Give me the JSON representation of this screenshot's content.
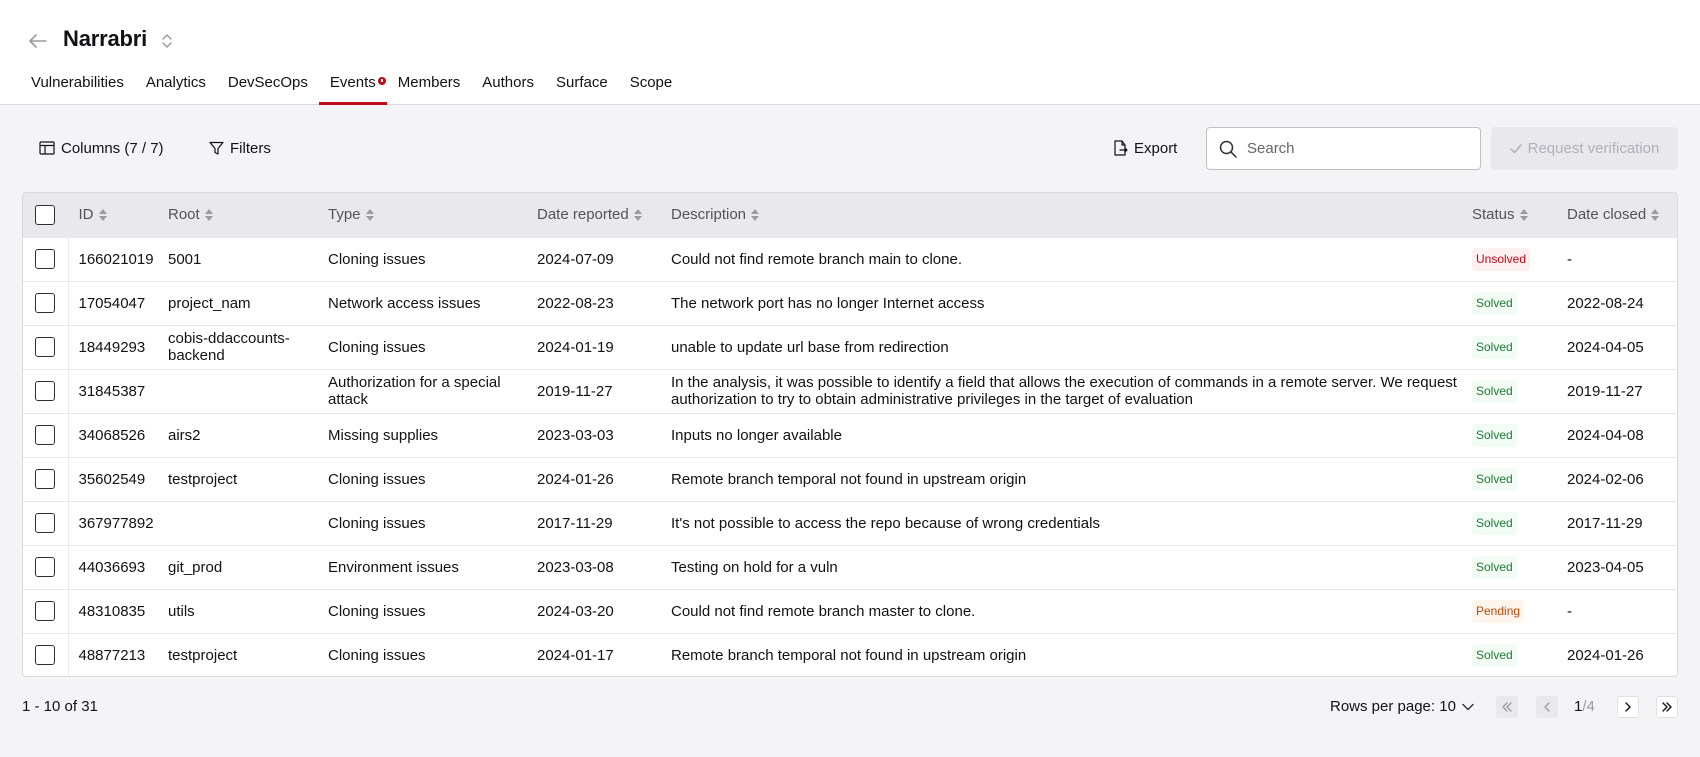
{
  "header": {
    "title": "Narrabri"
  },
  "tabs": [
    {
      "label": "Vulnerabilities"
    },
    {
      "label": "Analytics"
    },
    {
      "label": "DevSecOps"
    },
    {
      "label": "Events"
    },
    {
      "label": "Members"
    },
    {
      "label": "Authors"
    },
    {
      "label": "Surface"
    },
    {
      "label": "Scope"
    }
  ],
  "active_tab": "Events",
  "toolbar": {
    "columns_label": "Columns (7 / 7)",
    "filters_label": "Filters",
    "export_label": "Export",
    "search_placeholder": "Search",
    "request_label": "Request verification"
  },
  "table": {
    "columns": [
      "ID",
      "Root",
      "Type",
      "Date reported",
      "Description",
      "Status",
      "Date closed"
    ],
    "rows": [
      {
        "id": "166021019",
        "root": "5001",
        "type": "Cloning issues",
        "date_reported": "2024-07-09",
        "description": "Could not find remote branch main to clone.",
        "status": "Unsolved",
        "date_closed": "-"
      },
      {
        "id": "17054047",
        "root": "project_nam",
        "type": "Network access issues",
        "date_reported": "2022-08-23",
        "description": "The network port has no longer Internet access",
        "status": "Solved",
        "date_closed": "2022-08-24"
      },
      {
        "id": "18449293",
        "root": "cobis-ddaccounts-backend",
        "type": "Cloning issues",
        "date_reported": "2024-01-19",
        "description": "unable to update url base from redirection",
        "status": "Solved",
        "date_closed": "2024-04-05"
      },
      {
        "id": "31845387",
        "root": "",
        "type": "Authorization for a special attack",
        "date_reported": "2019-11-27",
        "description": "In the analysis, it was possible to identify a field that allows the execution of commands in a remote server. We request authorization to try to obtain administrative privileges in the target of evaluation",
        "status": "Solved",
        "date_closed": "2019-11-27"
      },
      {
        "id": "34068526",
        "root": "airs2",
        "type": "Missing supplies",
        "date_reported": "2023-03-03",
        "description": "Inputs no longer available",
        "status": "Solved",
        "date_closed": "2024-04-08"
      },
      {
        "id": "35602549",
        "root": "testproject",
        "type": "Cloning issues",
        "date_reported": "2024-01-26",
        "description": "Remote branch temporal not found in upstream origin",
        "status": "Solved",
        "date_closed": "2024-02-06"
      },
      {
        "id": "367977892",
        "root": "",
        "type": "Cloning issues",
        "date_reported": "2017-11-29",
        "description": "It's not possible to access the repo because of wrong credentials",
        "status": "Solved",
        "date_closed": "2017-11-29"
      },
      {
        "id": "44036693",
        "root": "git_prod",
        "type": "Environment issues",
        "date_reported": "2023-03-08",
        "description": "Testing on hold for a vuln",
        "status": "Solved",
        "date_closed": "2023-04-05"
      },
      {
        "id": "48310835",
        "root": "utils",
        "type": "Cloning issues",
        "date_reported": "2024-03-20",
        "description": "Could not find remote branch master to clone.",
        "status": "Pending",
        "date_closed": "-"
      },
      {
        "id": "48877213",
        "root": "testproject",
        "type": "Cloning issues",
        "date_reported": "2024-01-17",
        "description": "Remote branch temporal not found in upstream origin",
        "status": "Solved",
        "date_closed": "2024-01-26"
      }
    ]
  },
  "pagination": {
    "range_label": "1 - 10 of 31",
    "rows_per_page_label": "Rows per page: 10",
    "current_page": "1",
    "total_pages": "/4"
  },
  "colors": {
    "accent": "#bf0b1a",
    "solved": "#1f7a36",
    "pending": "#b5480a"
  }
}
